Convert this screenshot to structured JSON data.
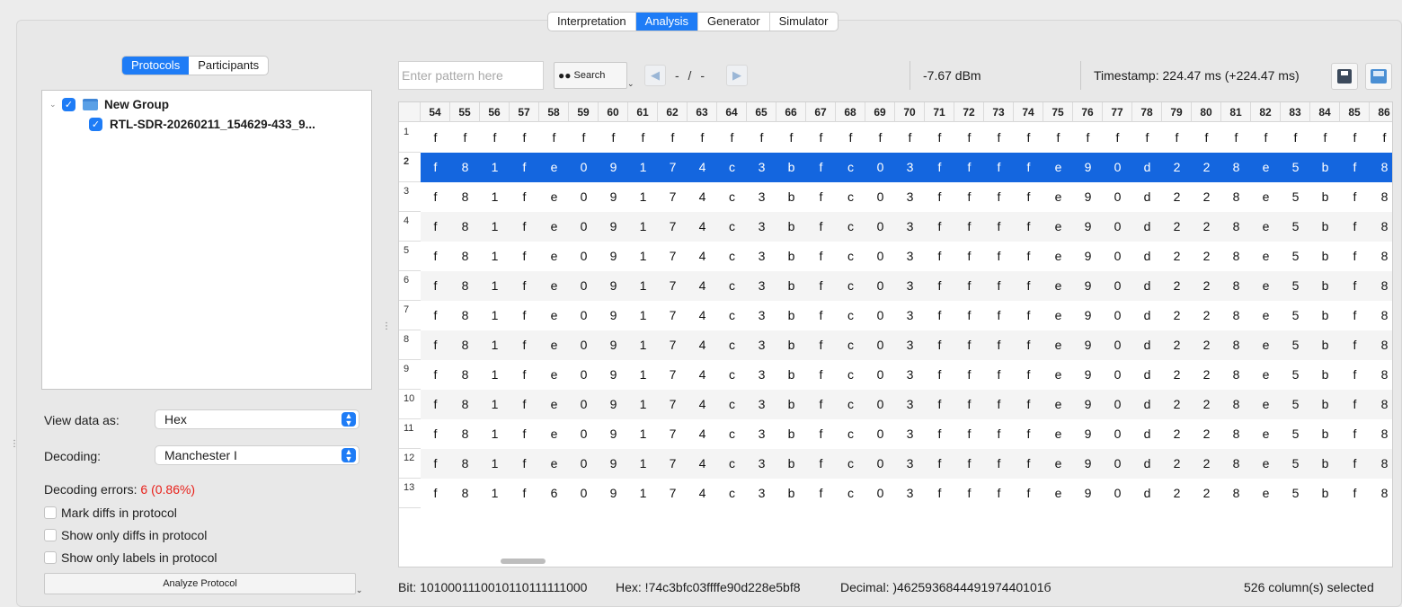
{
  "top_tabs": [
    {
      "label": "Interpretation",
      "active": false
    },
    {
      "label": "Analysis",
      "active": true
    },
    {
      "label": "Generator",
      "active": false
    },
    {
      "label": "Simulator",
      "active": false
    }
  ],
  "left": {
    "sub_tabs": [
      {
        "label": "Protocols",
        "active": true
      },
      {
        "label": "Participants",
        "active": false
      }
    ],
    "tree": {
      "group_label": "New Group",
      "group_checked": true,
      "item_label": "RTL-SDR-20260211_154629-433_9...",
      "item_checked": true
    },
    "view_label": "View data as:",
    "view_value": "Hex",
    "decoding_label": "Decoding:",
    "decoding_value": "Manchester I",
    "errors_label": "Decoding errors:",
    "errors_value": "6 (0.86%)",
    "checkboxes": [
      {
        "label": "Mark diffs in protocol",
        "checked": false
      },
      {
        "label": "Show only diffs in protocol",
        "checked": false
      },
      {
        "label": "Show only labels in protocol",
        "checked": false
      }
    ],
    "analyze_label": "Analyze Protocol"
  },
  "toolbar": {
    "pattern_placeholder": "Enter pattern here",
    "search_label": "Search",
    "nav_text": "- / -",
    "rssi": "-7.67 dBm",
    "timestamp": "Timestamp:  224.47 ms (+224.47 ms)"
  },
  "table": {
    "columns": [
      "54",
      "55",
      "56",
      "57",
      "58",
      "59",
      "60",
      "61",
      "62",
      "63",
      "64",
      "65",
      "66",
      "67",
      "68",
      "69",
      "70",
      "71",
      "72",
      "73",
      "74",
      "75",
      "76",
      "77",
      "78",
      "79",
      "80",
      "81",
      "82",
      "83",
      "84",
      "85",
      "86"
    ],
    "selected_row": 2,
    "rows": [
      {
        "num": "1",
        "cells": [
          "f",
          "f",
          "f",
          "f",
          "f",
          "f",
          "f",
          "f",
          "f",
          "f",
          "f",
          "f",
          "f",
          "f",
          "f",
          "f",
          "f",
          "f",
          "f",
          "f",
          "f",
          "f",
          "f",
          "f",
          "f",
          "f",
          "f",
          "f",
          "f",
          "f",
          "f",
          "f",
          "f"
        ]
      },
      {
        "num": "2",
        "cells": [
          "f",
          "8",
          "1",
          "f",
          "e",
          "0",
          "9",
          "1",
          "7",
          "4",
          "c",
          "3",
          "b",
          "f",
          "c",
          "0",
          "3",
          "f",
          "f",
          "f",
          "f",
          "e",
          "9",
          "0",
          "d",
          "2",
          "2",
          "8",
          "e",
          "5",
          "b",
          "f",
          "8"
        ]
      },
      {
        "num": "3",
        "cells": [
          "f",
          "8",
          "1",
          "f",
          "e",
          "0",
          "9",
          "1",
          "7",
          "4",
          "c",
          "3",
          "b",
          "f",
          "c",
          "0",
          "3",
          "f",
          "f",
          "f",
          "f",
          "e",
          "9",
          "0",
          "d",
          "2",
          "2",
          "8",
          "e",
          "5",
          "b",
          "f",
          "8"
        ]
      },
      {
        "num": "4",
        "cells": [
          "f",
          "8",
          "1",
          "f",
          "e",
          "0",
          "9",
          "1",
          "7",
          "4",
          "c",
          "3",
          "b",
          "f",
          "c",
          "0",
          "3",
          "f",
          "f",
          "f",
          "f",
          "e",
          "9",
          "0",
          "d",
          "2",
          "2",
          "8",
          "e",
          "5",
          "b",
          "f",
          "8"
        ]
      },
      {
        "num": "5",
        "cells": [
          "f",
          "8",
          "1",
          "f",
          "e",
          "0",
          "9",
          "1",
          "7",
          "4",
          "c",
          "3",
          "b",
          "f",
          "c",
          "0",
          "3",
          "f",
          "f",
          "f",
          "f",
          "e",
          "9",
          "0",
          "d",
          "2",
          "2",
          "8",
          "e",
          "5",
          "b",
          "f",
          "8"
        ]
      },
      {
        "num": "6",
        "cells": [
          "f",
          "8",
          "1",
          "f",
          "e",
          "0",
          "9",
          "1",
          "7",
          "4",
          "c",
          "3",
          "b",
          "f",
          "c",
          "0",
          "3",
          "f",
          "f",
          "f",
          "f",
          "e",
          "9",
          "0",
          "d",
          "2",
          "2",
          "8",
          "e",
          "5",
          "b",
          "f",
          "8"
        ]
      },
      {
        "num": "7",
        "cells": [
          "f",
          "8",
          "1",
          "f",
          "e",
          "0",
          "9",
          "1",
          "7",
          "4",
          "c",
          "3",
          "b",
          "f",
          "c",
          "0",
          "3",
          "f",
          "f",
          "f",
          "f",
          "e",
          "9",
          "0",
          "d",
          "2",
          "2",
          "8",
          "e",
          "5",
          "b",
          "f",
          "8"
        ]
      },
      {
        "num": "8",
        "cells": [
          "f",
          "8",
          "1",
          "f",
          "e",
          "0",
          "9",
          "1",
          "7",
          "4",
          "c",
          "3",
          "b",
          "f",
          "c",
          "0",
          "3",
          "f",
          "f",
          "f",
          "f",
          "e",
          "9",
          "0",
          "d",
          "2",
          "2",
          "8",
          "e",
          "5",
          "b",
          "f",
          "8"
        ]
      },
      {
        "num": "9",
        "cells": [
          "f",
          "8",
          "1",
          "f",
          "e",
          "0",
          "9",
          "1",
          "7",
          "4",
          "c",
          "3",
          "b",
          "f",
          "c",
          "0",
          "3",
          "f",
          "f",
          "f",
          "f",
          "e",
          "9",
          "0",
          "d",
          "2",
          "2",
          "8",
          "e",
          "5",
          "b",
          "f",
          "8"
        ]
      },
      {
        "num": "10",
        "cells": [
          "f",
          "8",
          "1",
          "f",
          "e",
          "0",
          "9",
          "1",
          "7",
          "4",
          "c",
          "3",
          "b",
          "f",
          "c",
          "0",
          "3",
          "f",
          "f",
          "f",
          "f",
          "e",
          "9",
          "0",
          "d",
          "2",
          "2",
          "8",
          "e",
          "5",
          "b",
          "f",
          "8"
        ]
      },
      {
        "num": "11",
        "cells": [
          "f",
          "8",
          "1",
          "f",
          "e",
          "0",
          "9",
          "1",
          "7",
          "4",
          "c",
          "3",
          "b",
          "f",
          "c",
          "0",
          "3",
          "f",
          "f",
          "f",
          "f",
          "e",
          "9",
          "0",
          "d",
          "2",
          "2",
          "8",
          "e",
          "5",
          "b",
          "f",
          "8"
        ]
      },
      {
        "num": "12",
        "cells": [
          "f",
          "8",
          "1",
          "f",
          "e",
          "0",
          "9",
          "1",
          "7",
          "4",
          "c",
          "3",
          "b",
          "f",
          "c",
          "0",
          "3",
          "f",
          "f",
          "f",
          "f",
          "e",
          "9",
          "0",
          "d",
          "2",
          "2",
          "8",
          "e",
          "5",
          "b",
          "f",
          "8"
        ]
      },
      {
        "num": "13",
        "cells": [
          "f",
          "8",
          "1",
          "f",
          "6",
          "0",
          "9",
          "1",
          "7",
          "4",
          "c",
          "3",
          "b",
          "f",
          "c",
          "0",
          "3",
          "f",
          "f",
          "f",
          "f",
          "e",
          "9",
          "0",
          "d",
          "2",
          "2",
          "8",
          "e",
          "5",
          "b",
          "f",
          "8"
        ]
      }
    ]
  },
  "status": {
    "bit": "Bit:  1010001110010110111111000",
    "hex": "Hex:  !74c3bfc03ffffe90d228e5bf8",
    "decimal": "Decimal:  )462593684449197440101б",
    "selected": "526  column(s) selected"
  },
  "colors": {
    "accent": "#1e7cf6",
    "selection": "#1466df",
    "error": "#e8201a"
  }
}
